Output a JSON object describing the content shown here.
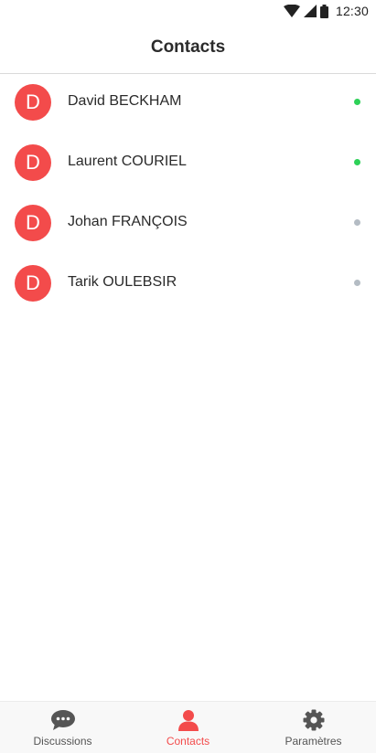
{
  "status_bar": {
    "time": "12:30",
    "icons": [
      "wifi-icon",
      "signal-icon",
      "battery-icon"
    ]
  },
  "header": {
    "title": "Contacts"
  },
  "contacts": [
    {
      "initial": "D",
      "name": "David BECKHAM",
      "status": "online"
    },
    {
      "initial": "D",
      "name": "Laurent COURIEL",
      "status": "online"
    },
    {
      "initial": "D",
      "name": "Johan FRANÇOIS",
      "status": "offline"
    },
    {
      "initial": "D",
      "name": "Tarik OULEBSIR",
      "status": "offline"
    }
  ],
  "tab_bar": {
    "tabs": [
      {
        "label": "Discussions",
        "icon": "chat-bubble-icon",
        "active": false
      },
      {
        "label": "Contacts",
        "icon": "person-icon",
        "active": true
      },
      {
        "label": "Paramètres",
        "icon": "gear-icon",
        "active": false
      }
    ]
  },
  "colors": {
    "accent": "#f34b4b",
    "online": "#2ed158",
    "offline": "#b4bcc4",
    "inactive_tab": "#555555"
  }
}
